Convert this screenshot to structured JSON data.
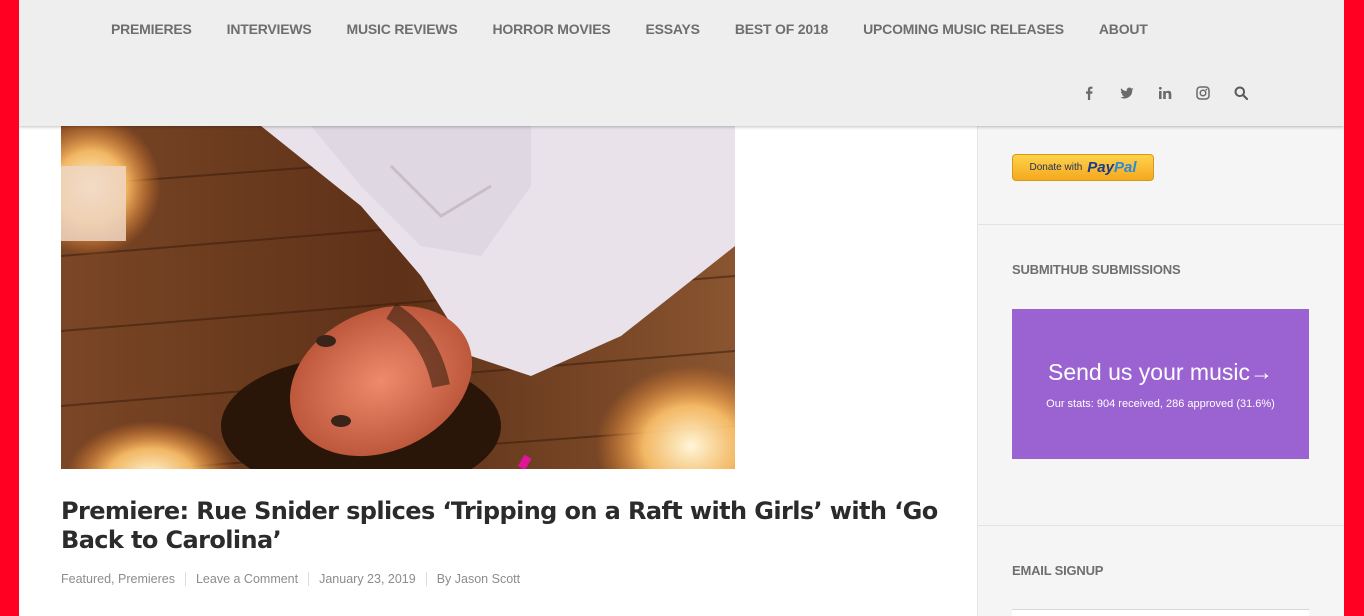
{
  "nav": {
    "items": [
      {
        "label": "PREMIERES"
      },
      {
        "label": "INTERVIEWS"
      },
      {
        "label": "MUSIC REVIEWS"
      },
      {
        "label": "HORROR MOVIES"
      },
      {
        "label": "ESSAYS"
      },
      {
        "label": "BEST OF 2018"
      },
      {
        "label": "UPCOMING MUSIC RELEASES"
      },
      {
        "label": "ABOUT"
      }
    ]
  },
  "social": {
    "icons": [
      "facebook-icon",
      "twitter-icon",
      "linkedin-icon",
      "instagram-icon",
      "search-icon"
    ]
  },
  "post": {
    "title": "Premiere: Rue Snider splices ‘Tripping on a Raft with Girls’ with ‘Go Back to Carolina’",
    "categories": [
      "Featured",
      "Premieres"
    ],
    "category_separator": ",",
    "comment_link": "Leave a Comment",
    "date": "January 23, 2019",
    "author": "By Jason Scott"
  },
  "sidebar": {
    "paypal": {
      "prefix": "Donate with",
      "brand_pay": "Pay",
      "brand_pal": "Pal"
    },
    "submithub": {
      "title": "SUBMITHUB SUBMISSIONS",
      "cta": "Send us your music→",
      "stats": "Our stats: 904 received, 286 approved (31.6%)"
    },
    "email": {
      "title": "EMAIL SIGNUP"
    }
  },
  "colors": {
    "border": "#ff0022",
    "header_bg": "#eeeeee",
    "submithub_bg": "#9b63d1",
    "paypal_gold": "#f4a81f"
  }
}
